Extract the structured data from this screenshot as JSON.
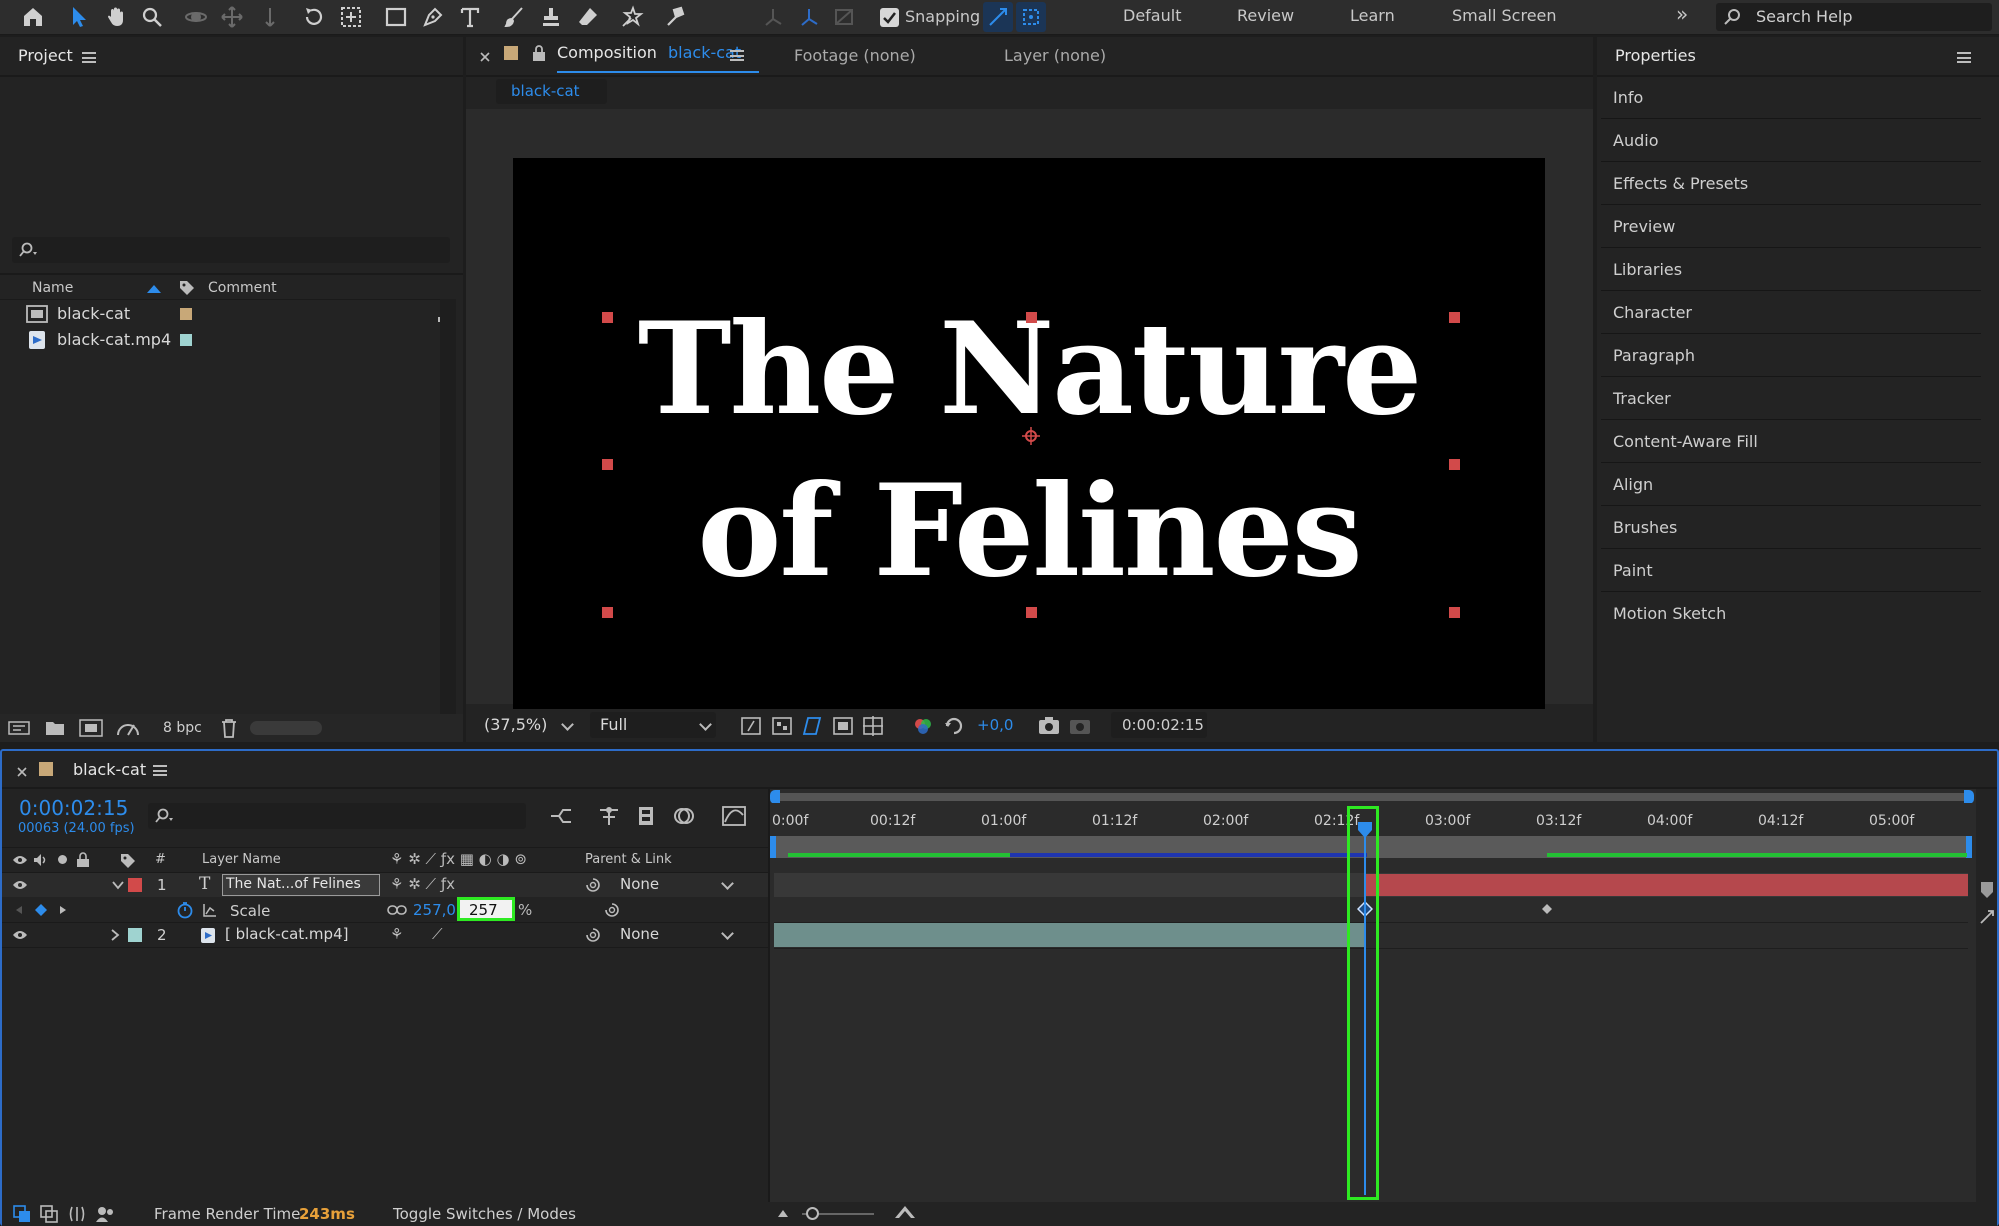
{
  "toolbar": {
    "snapping_label": "Snapping",
    "workspaces": [
      "Default",
      "Review",
      "Learn",
      "Small Screen"
    ],
    "more_label": "»",
    "search_placeholder": "Search Help"
  },
  "project": {
    "title": "Project",
    "columns": {
      "name": "Name",
      "comment": "Comment"
    },
    "items": [
      {
        "name": "black-cat",
        "label_color": "#c8a878"
      },
      {
        "name": "black-cat.mp4",
        "label_color": "#9fd3d0"
      }
    ],
    "bpc_label": "8 bpc"
  },
  "composition": {
    "tab_prefix": "Composition",
    "tab_name": "black-cat",
    "footage_tab": "Footage (none)",
    "layer_tab": "Layer (none)",
    "breadcrumb": "black-cat",
    "canvas_text_line1": "The Nature",
    "canvas_text_line2": "of Felines",
    "zoom": "(37,5%)",
    "resolution": "Full",
    "exposure": "+0,0",
    "timecode": "0:00:02:15"
  },
  "properties": {
    "title": "Properties",
    "items": [
      "Info",
      "Audio",
      "Effects & Presets",
      "Preview",
      "Libraries",
      "Character",
      "Paragraph",
      "Tracker",
      "Content-Aware Fill",
      "Align",
      "Brushes",
      "Paint",
      "Motion Sketch"
    ]
  },
  "timeline": {
    "comp_name": "black-cat",
    "timecode": "0:00:02:15",
    "frame_info": "00063 (24.00 fps)",
    "headers": {
      "num": "#",
      "layer_name": "Layer Name",
      "parent": "Parent & Link"
    },
    "layers": [
      {
        "num": "1",
        "name": "The Nat...of Felines",
        "parent": "None",
        "label_color": "#d24a4a"
      },
      {
        "num": "2",
        "name": "[ black-cat.mp4]",
        "parent": "None",
        "label_color": "#9fd3d0"
      }
    ],
    "scale_property": {
      "name": "Scale",
      "value_x": "257,0",
      "value_y": "257",
      "unit": "%"
    },
    "ruler_ticks": [
      "0:00f",
      "00:12f",
      "01:00f",
      "01:12f",
      "02:00f",
      "02:12f",
      "03:00f",
      "03:12f",
      "04:00f",
      "04:12f",
      "05:00f"
    ],
    "footer": {
      "render_label": "Frame Render Time",
      "render_value": "243ms",
      "toggle_label": "Toggle Switches / Modes"
    }
  },
  "colors": {
    "accent": "#2d8ceb",
    "highlight": "#2eea22",
    "red_bar": "#b5484d"
  }
}
